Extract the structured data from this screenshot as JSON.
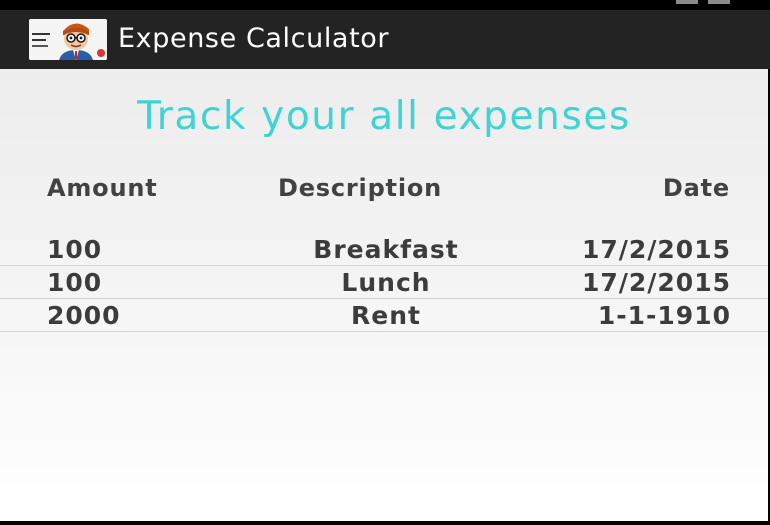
{
  "app": {
    "title": "Expense Calculator",
    "icon": "app-icon-cartoon-face"
  },
  "headline": "Track your all expenses",
  "table": {
    "columns": [
      "Amount",
      "Description",
      "Date"
    ],
    "rows": [
      {
        "amount": "100",
        "description": "Breakfast",
        "date": "17/2/2015"
      },
      {
        "amount": "100",
        "description": "Lunch",
        "date": "17/2/2015"
      },
      {
        "amount": "2000",
        "description": "Rent",
        "date": "1-1-1910"
      }
    ]
  },
  "colors": {
    "action_bar": "#232323",
    "headline": "#3fd3d3",
    "text": "#3c3c3c"
  }
}
